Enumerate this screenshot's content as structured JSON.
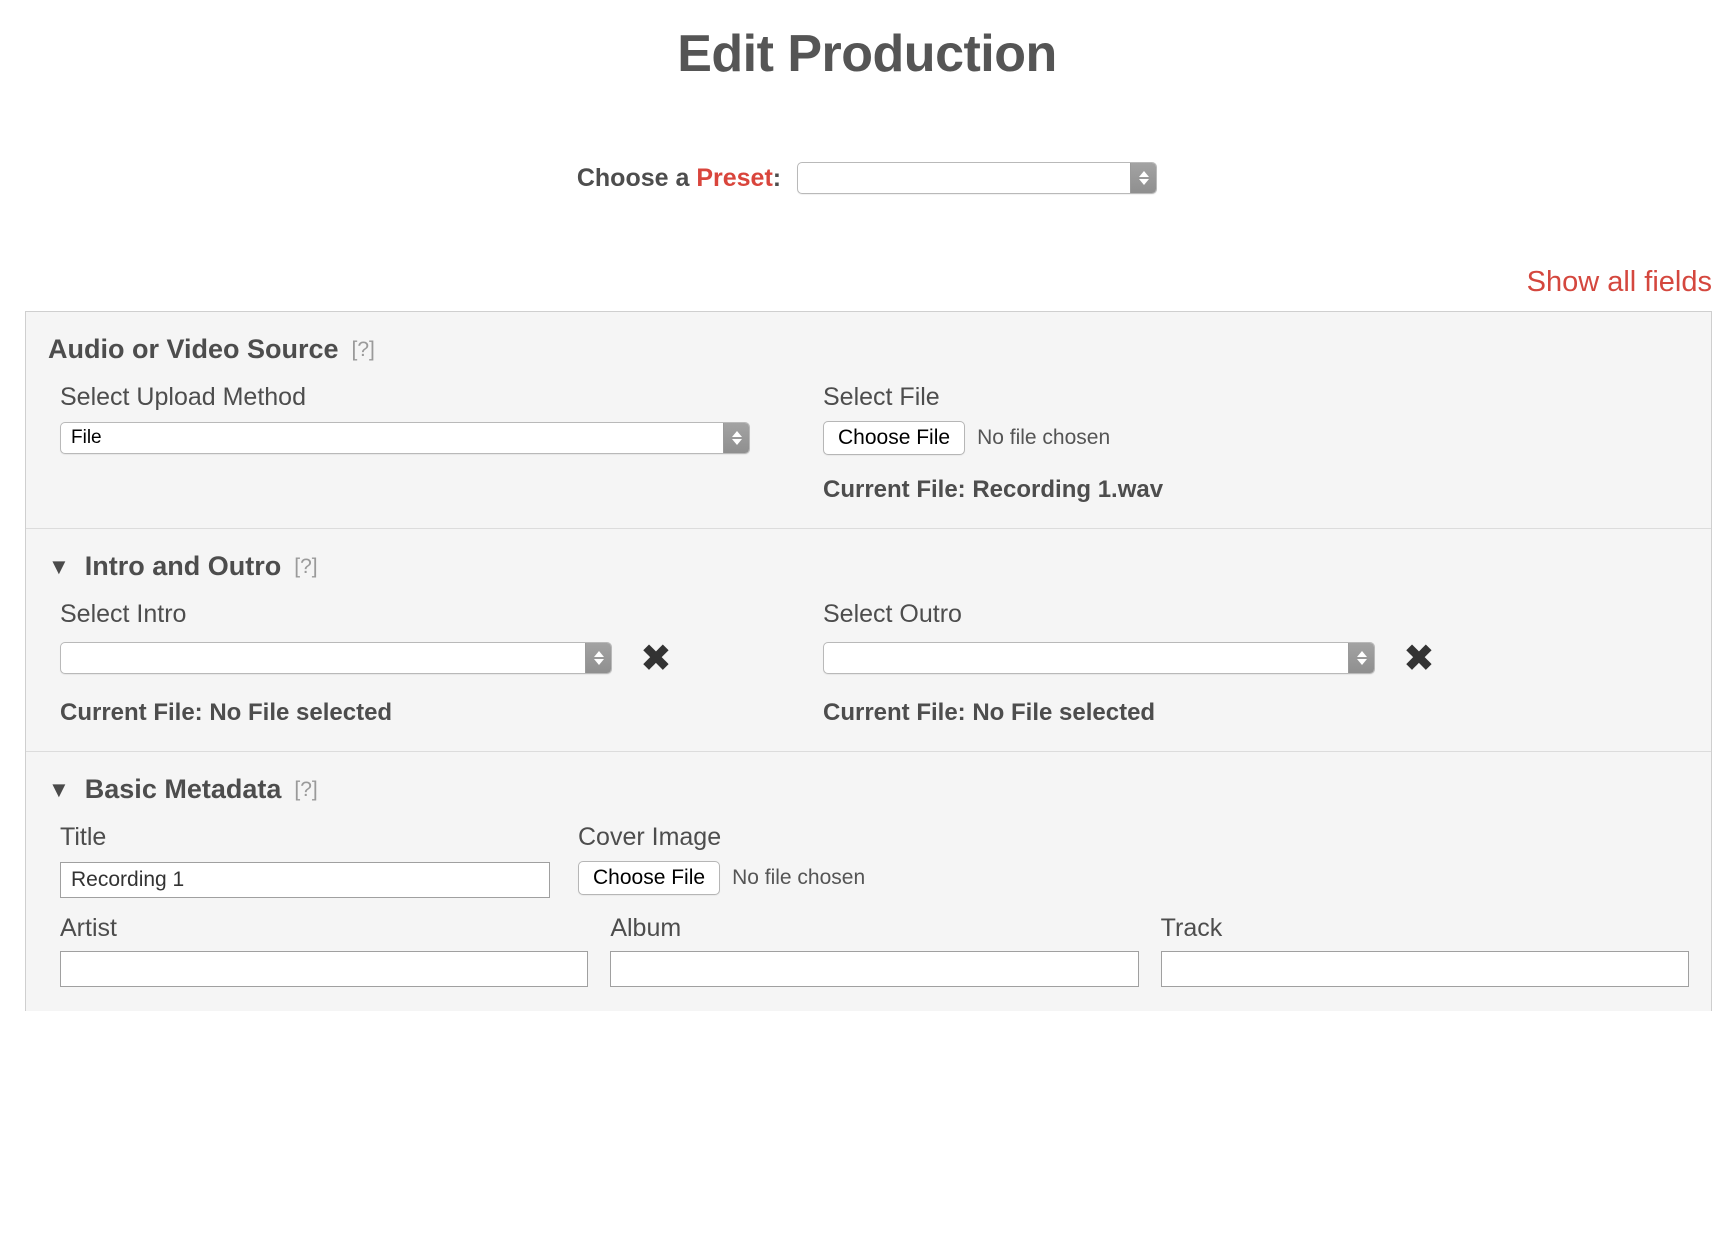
{
  "page": {
    "title": "Edit Production"
  },
  "preset": {
    "label_prefix": "Choose a ",
    "label_accent": "Preset",
    "label_suffix": ":",
    "value": "",
    "accent_color": "#d9453c"
  },
  "show_all_fields": {
    "label": "Show all fields",
    "color": "#d4473e"
  },
  "sections": {
    "source": {
      "title": "Audio or Video Source",
      "help": "[?]",
      "upload_method_label": "Select Upload Method",
      "upload_method_value": "File",
      "select_file_label": "Select File",
      "choose_file_button": "Choose File",
      "no_file_text": "No file chosen",
      "current_file": "Current File: Recording 1.wav"
    },
    "intro_outro": {
      "triangle": "▼",
      "title": "Intro and Outro",
      "help": "[?]",
      "intro_label": "Select Intro",
      "intro_value": "",
      "intro_clear": "✖",
      "intro_current_file": "Current File: No File selected",
      "outro_label": "Select Outro",
      "outro_value": "",
      "outro_clear": "✖",
      "outro_current_file": "Current File: No File selected"
    },
    "basic_metadata": {
      "triangle": "▼",
      "title": "Basic Metadata",
      "help": "[?]",
      "title_label": "Title",
      "title_value": "Recording 1",
      "cover_label": "Cover Image",
      "cover_choose_button": "Choose File",
      "cover_no_file": "No file chosen",
      "artist_label": "Artist",
      "artist_value": "",
      "album_label": "Album",
      "album_value": "",
      "track_label": "Track",
      "track_value": ""
    }
  }
}
